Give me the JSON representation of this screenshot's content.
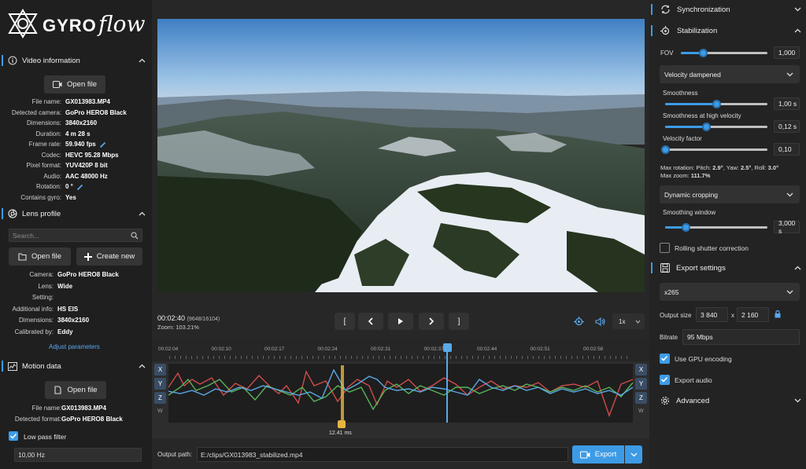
{
  "app": {
    "name_part1": "GYRO",
    "name_part2": "flow"
  },
  "video_info": {
    "title": "Video information",
    "open_file": "Open file",
    "rows": [
      {
        "k": "File name:",
        "v": "GX013983.MP4"
      },
      {
        "k": "Detected camera:",
        "v": "GoPro HERO8 Black"
      },
      {
        "k": "Dimensions:",
        "v": "3840x2160"
      },
      {
        "k": "Duration:",
        "v": "4 m 28 s"
      },
      {
        "k": "Frame rate:",
        "v": "59.940 fps"
      },
      {
        "k": "Codec:",
        "v": "HEVC 95.28 Mbps"
      },
      {
        "k": "Pixel format:",
        "v": "YUV420P 8 bit"
      },
      {
        "k": "Audio:",
        "v": "AAC 48000 Hz"
      },
      {
        "k": "Rotation:",
        "v": "0 °"
      },
      {
        "k": "Contains gyro:",
        "v": "Yes"
      }
    ]
  },
  "lens": {
    "title": "Lens profile",
    "search_placeholder": "Search...",
    "open_file": "Open file",
    "create_new": "Create new",
    "rows": [
      {
        "k": "Camera:",
        "v": "GoPro HERO8 Black"
      },
      {
        "k": "Lens:",
        "v": "Wide"
      },
      {
        "k": "Setting:",
        "v": ""
      },
      {
        "k": "Additional info:",
        "v": "HS EIS"
      },
      {
        "k": "Dimensions:",
        "v": "3840x2160"
      },
      {
        "k": "Calibrated by:",
        "v": "Eddy"
      }
    ],
    "adjust": "Adjust parameters"
  },
  "motion": {
    "title": "Motion data",
    "open_file": "Open file",
    "rows": [
      {
        "k": "File name:",
        "v": "GX013983.MP4"
      },
      {
        "k": "Detected format:",
        "v": "GoPro HERO8 Black"
      }
    ],
    "low_pass": "Low pass filter",
    "low_pass_value": "10,00 Hz"
  },
  "player": {
    "time": "00:02:40",
    "frames": "(9648/16104)",
    "zoom": "Zoom: 103.21%",
    "bracket_left": "[",
    "bracket_right": "]",
    "speed": "1x"
  },
  "timeline": {
    "ticks": [
      "00:02:04",
      "00:02:10",
      "00:02:17",
      "00:02:24",
      "00:02:31",
      "00:02:37",
      "00:02:44",
      "00:02:51",
      "00:02:58"
    ],
    "axes_left": [
      "X",
      "Y",
      "Z",
      "W"
    ],
    "axes_right": [
      "X",
      "Y",
      "Z",
      "W"
    ],
    "marker_label": "12.41 ms",
    "playhead_fraction": 0.6
  },
  "output": {
    "label": "Output path:",
    "path": "E:/clips/GX013983_stabilized.mp4",
    "export": "Export"
  },
  "sync": {
    "title": "Synchronization"
  },
  "stab": {
    "title": "Stabilization",
    "fov_label": "FOV",
    "fov_value": "1,000",
    "fov_fraction": 0.26,
    "method": "Velocity dampened",
    "smoothness_label": "Smoothness",
    "smoothness_value": "1,00 s",
    "smoothness_fraction": 0.5,
    "shv_label": "Smoothness at high velocity",
    "shv_value": "0,12 s",
    "shv_fraction": 0.4,
    "vf_label": "Velocity factor",
    "vf_value": "0,10",
    "vf_fraction": 0.0,
    "max_rot_prefix": "Max rotation: Pitch: ",
    "pitch": "2.9°",
    "yaw_prefix": ", Yaw: ",
    "yaw": "2.5°",
    "roll_prefix": ", Roll: ",
    "roll": "3.0°",
    "max_zoom_prefix": "Max zoom: ",
    "max_zoom": "111.7%",
    "cropping": "Dynamic cropping",
    "window_label": "Smoothing window",
    "window_value": "3,000 s",
    "window_fraction": 0.2,
    "rolling": "Rolling shutter correction"
  },
  "export": {
    "title": "Export settings",
    "codec": "x265",
    "output_size_label": "Output size",
    "width": "3 840",
    "x": "x",
    "height": "2 160",
    "bitrate_label": "Bitrate",
    "bitrate": "95 Mbps",
    "gpu": "Use GPU encoding",
    "audio": "Export audio"
  },
  "advanced": {
    "title": "Advanced"
  },
  "colors": {
    "accent": "#3d9be6",
    "panel": "#1f1f1f",
    "background": "#272727"
  }
}
